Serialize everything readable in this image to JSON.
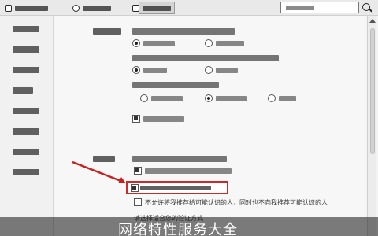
{
  "top_toolbar": {
    "tabs": [
      {
        "icon": "settings-icon"
      },
      {
        "icon": "shield-icon"
      },
      {
        "icon": "home-icon"
      }
    ],
    "search": {
      "placeholder": ""
    }
  },
  "sidebar": {
    "items": [
      {
        "label": ""
      },
      {
        "label": ""
      },
      {
        "label": ""
      },
      {
        "label": ""
      },
      {
        "label": ""
      },
      {
        "label": ""
      },
      {
        "label": ""
      },
      {
        "label": ""
      }
    ]
  },
  "main": {
    "privacy_section": {
      "label": "",
      "question1": {
        "text": "",
        "options": [
          "",
          ""
        ],
        "selected": 0
      },
      "question2": {
        "text": "",
        "options": [
          "",
          ""
        ],
        "selected": 0
      },
      "question3": {
        "text": "",
        "options": [
          "",
          "",
          ""
        ],
        "selected": 1
      },
      "checkbox1": {
        "label": "",
        "checked": true
      }
    },
    "recommend_section": {
      "label": "",
      "checkbox_a": {
        "label": "",
        "checked": true
      },
      "checkbox_highlighted": {
        "label": "",
        "checked": true
      },
      "checkbox_c": {
        "label": "不允许将我推荐给可能认识的人，同时也不向我推荐可能认识的人",
        "checked": false
      },
      "verify_label": "请选择适合您的验证方式"
    }
  },
  "caption": {
    "text": "网络特性服务大全"
  },
  "colors": {
    "highlight": "#d02828",
    "caption_bg": "#333333"
  }
}
